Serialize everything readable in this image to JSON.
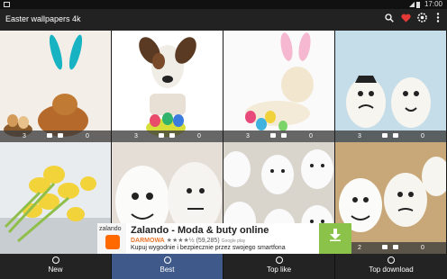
{
  "app": {
    "title": "Easter wallpapers 4k"
  },
  "status_bar": {
    "time": "17:00"
  },
  "toolbar": {
    "icons": [
      "search-icon",
      "heart-icon",
      "settings-icon",
      "more-vert-icon"
    ],
    "accent": "#e53935"
  },
  "grid": {
    "cells": [
      {
        "likes": "3",
        "dislikes": "0"
      },
      {
        "likes": "3",
        "dislikes": "0"
      },
      {
        "likes": "3",
        "dislikes": "0"
      },
      {
        "likes": "3",
        "dislikes": "0"
      },
      {
        "likes": "",
        "dislikes": ""
      },
      {
        "likes": "",
        "dislikes": ""
      },
      {
        "likes": "",
        "dislikes": ""
      },
      {
        "likes": "2",
        "dislikes": "0"
      }
    ]
  },
  "ad": {
    "logo_text": "zalando",
    "headline": "Zalando - Moda & buty online",
    "price": "DARMOWA",
    "rating_stars": "★★★★½",
    "rating_count": "(59,285)",
    "store": "Google play",
    "description": "Kupuj wygodnie i bezpiecznie przez swojego smartfona",
    "button_color": "#8bc34a"
  },
  "tabs": [
    {
      "label": "New",
      "active": false
    },
    {
      "label": "Best",
      "active": true
    },
    {
      "label": "Top like",
      "active": false
    },
    {
      "label": "Top download",
      "active": false
    }
  ]
}
